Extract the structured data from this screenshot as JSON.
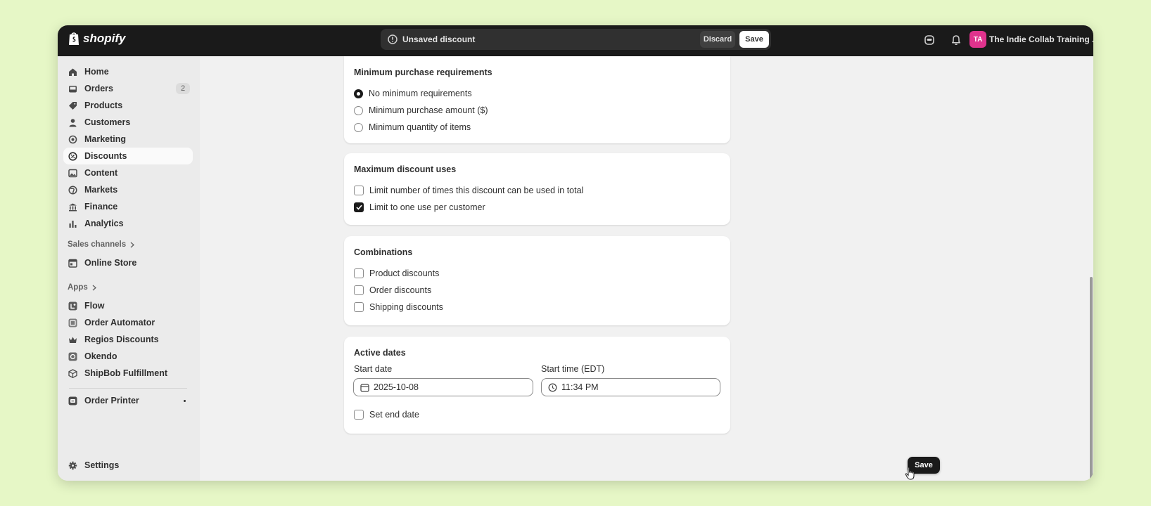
{
  "topbar": {
    "logo_text": "shopify",
    "unsaved_text": "Unsaved discount",
    "discard_label": "Discard",
    "save_label": "Save",
    "avatar_initials": "TA",
    "store_name": "The Indie Collab Training ..."
  },
  "sidebar": {
    "items": [
      {
        "label": "Home",
        "icon": "home-icon"
      },
      {
        "label": "Orders",
        "icon": "inbox-icon",
        "badge": "2"
      },
      {
        "label": "Products",
        "icon": "tag-icon"
      },
      {
        "label": "Customers",
        "icon": "person-icon"
      },
      {
        "label": "Marketing",
        "icon": "target-icon"
      },
      {
        "label": "Discounts",
        "icon": "discount-icon",
        "active": true
      },
      {
        "label": "Content",
        "icon": "image-icon"
      },
      {
        "label": "Markets",
        "icon": "globe-icon"
      },
      {
        "label": "Finance",
        "icon": "bank-icon"
      },
      {
        "label": "Analytics",
        "icon": "bar-chart-icon"
      }
    ],
    "sales_channels_title": "Sales channels",
    "online_store": "Online Store",
    "apps_title": "Apps",
    "apps": [
      {
        "label": "Flow",
        "icon": "flow-icon"
      },
      {
        "label": "Order Automator",
        "icon": "order-automator-icon"
      },
      {
        "label": "Regios Discounts",
        "icon": "crown-icon"
      },
      {
        "label": "Okendo",
        "icon": "okendo-icon"
      },
      {
        "label": "ShipBob Fulfillment",
        "icon": "box-icon"
      }
    ],
    "order_printer": "Order Printer",
    "settings": "Settings"
  },
  "min_purchase": {
    "title": "Minimum purchase requirements",
    "options": [
      "No minimum requirements",
      "Minimum purchase amount ($)",
      "Minimum quantity of items"
    ],
    "selected": 0
  },
  "max_uses": {
    "title": "Maximum discount uses",
    "options": [
      {
        "label": "Limit number of times this discount can be used in total",
        "checked": false
      },
      {
        "label": "Limit to one use per customer",
        "checked": true
      }
    ]
  },
  "combinations": {
    "title": "Combinations",
    "options": [
      {
        "label": "Product discounts",
        "checked": false
      },
      {
        "label": "Order discounts",
        "checked": false
      },
      {
        "label": "Shipping discounts",
        "checked": false
      }
    ]
  },
  "active_dates": {
    "title": "Active dates",
    "start_date_label": "Start date",
    "start_date_value": "2025-10-08",
    "start_time_label": "Start time (EDT)",
    "start_time_value": "11:34 PM",
    "set_end_date_label": "Set end date",
    "set_end_date_checked": false
  },
  "floating_save_label": "Save",
  "colors": {
    "background": "#e6f7c6",
    "topbar": "#1a1a1a",
    "avatar": "#e0338d"
  }
}
